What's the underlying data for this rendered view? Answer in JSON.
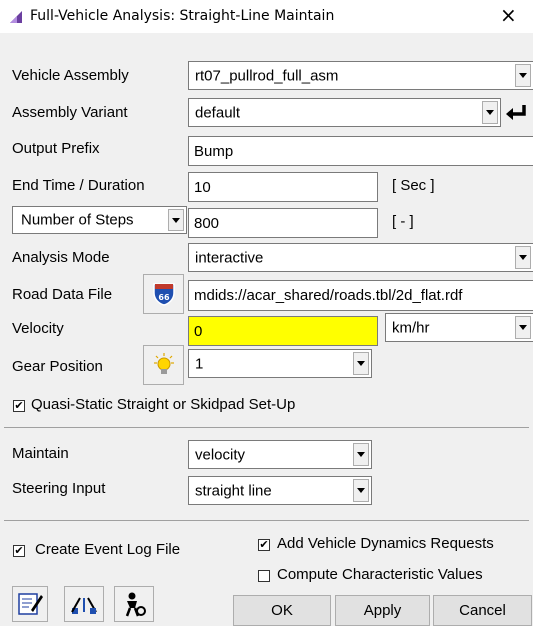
{
  "window": {
    "title": "Full-Vehicle Analysis: Straight-Line Maintain",
    "close_glyph": "×"
  },
  "form": {
    "vehicle_assembly": {
      "label": "Vehicle Assembly",
      "value": "rt07_pullrod_full_asm"
    },
    "assembly_variant": {
      "label": "Assembly Variant",
      "value": "default"
    },
    "output_prefix": {
      "label": "Output Prefix",
      "value": "Bump"
    },
    "end_time": {
      "label": "End Time / Duration",
      "value": "10",
      "unit": "[ Sec ]"
    },
    "steps": {
      "selector": "Number of Steps",
      "value": "800",
      "unit": "[ - ]"
    },
    "analysis_mode": {
      "label": "Analysis Mode",
      "value": "interactive"
    },
    "road_data_file": {
      "label": "Road Data File",
      "value": "mdids://acar_shared/roads.tbl/2d_flat.rdf"
    },
    "velocity": {
      "label": "Velocity",
      "value": "0",
      "unit": "km/hr"
    },
    "gear_position": {
      "label": "Gear Position",
      "value": "1"
    },
    "quasi_static": {
      "label": "Quasi-Static Straight or Skidpad Set-Up",
      "checked": true
    }
  },
  "control": {
    "maintain": {
      "label": "Maintain",
      "value": "velocity"
    },
    "steering_input": {
      "label": "Steering Input",
      "value": "straight line"
    }
  },
  "options": {
    "create_event_log": {
      "label": "Create Event Log File",
      "checked": true
    },
    "add_vehicle_dynamics": {
      "label": "Add Vehicle Dynamics Requests",
      "checked": true
    },
    "compute_characteristic": {
      "label": "Compute Characteristic Values",
      "checked": false
    }
  },
  "buttons": {
    "ok": "OK",
    "apply": "Apply",
    "cancel": "Cancel"
  },
  "colors": {
    "highlight": "#ffff00",
    "window_bg": "#f0f0f0"
  },
  "check_glyph": "✔"
}
